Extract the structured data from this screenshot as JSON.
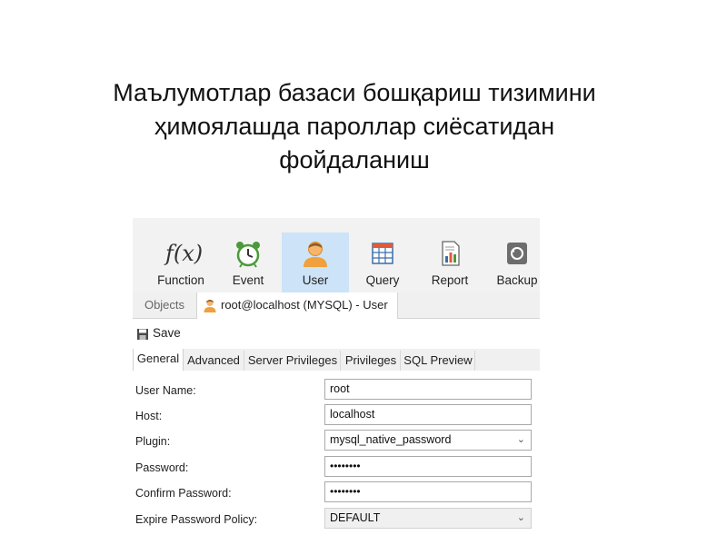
{
  "slide": {
    "title_lines": [
      "Маълумотлар базаси бошқариш тизимини",
      "ҳимоялашда пароллар сиёсатидан",
      "фойдаланиш"
    ]
  },
  "toolbar": {
    "items": [
      {
        "label": "Function",
        "icon": "function-icon"
      },
      {
        "label": "Event",
        "icon": "alarm-clock-icon"
      },
      {
        "label": "User",
        "icon": "user-icon",
        "active": true
      },
      {
        "label": "Query",
        "icon": "query-table-icon"
      },
      {
        "label": "Report",
        "icon": "report-icon"
      },
      {
        "label": "Backup",
        "icon": "backup-icon"
      }
    ],
    "function_glyph": "f(x)"
  },
  "tabs": {
    "objects": "Objects",
    "user_tab": "root@localhost (MYSQL) - User"
  },
  "save_label": "Save",
  "subtabs": [
    "General",
    "Advanced",
    "Server Privileges",
    "Privileges",
    "SQL Preview"
  ],
  "form": {
    "user_name": {
      "label": "User Name:",
      "value": "root"
    },
    "host": {
      "label": "Host:",
      "value": "localhost"
    },
    "plugin": {
      "label": "Plugin:",
      "value": "mysql_native_password"
    },
    "password": {
      "label": "Password:",
      "value": "••••••••"
    },
    "confirm_password": {
      "label": "Confirm Password:",
      "value": "••••••••"
    },
    "expire_policy": {
      "label": "Expire Password Policy:",
      "value": "DEFAULT"
    }
  },
  "colors": {
    "active_toolbar": "#cde3f7",
    "toolbar_bg": "#f2f2f2"
  }
}
